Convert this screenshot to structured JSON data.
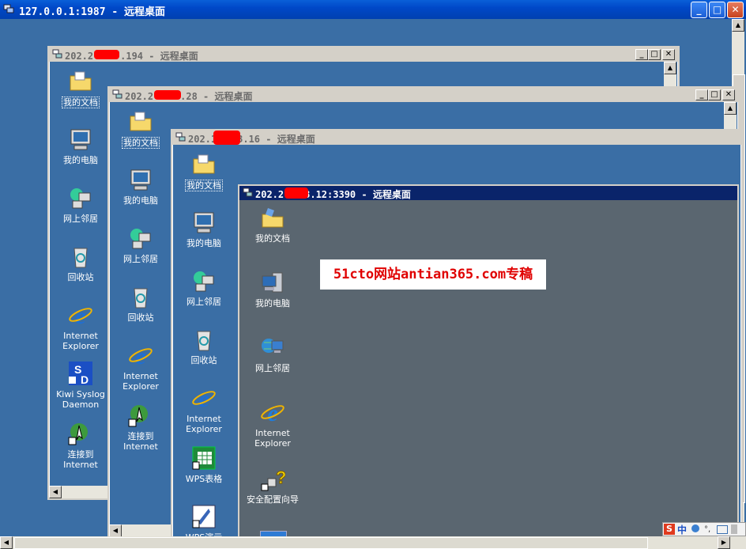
{
  "outer": {
    "title": "127.0.0.1:1987 - 远程桌面",
    "minimize": "_",
    "maximize": "□",
    "close": "✕"
  },
  "windows": [
    {
      "title_prefix": "202.2",
      "title_suffix": ".194 - 远程桌面",
      "icons": [
        {
          "label": "我的文档",
          "icon": "folder-icon"
        },
        {
          "label": "我的电脑",
          "icon": "computer-icon"
        },
        {
          "label": "网上邻居",
          "icon": "network-icon"
        },
        {
          "label": "回收站",
          "icon": "recycle-bin-icon"
        },
        {
          "label": "Internet Explorer",
          "icon": "ie-icon"
        },
        {
          "label": "Kiwi Syslog Daemon",
          "icon": "kiwi-icon"
        },
        {
          "label": "连接到 Internet",
          "icon": "connect-icon"
        }
      ]
    },
    {
      "title_prefix": "202.2",
      "title_suffix": ".28 - 远程桌面",
      "icons": [
        {
          "label": "我的文档",
          "icon": "folder-icon"
        },
        {
          "label": "我的电脑",
          "icon": "computer-icon"
        },
        {
          "label": "网上邻居",
          "icon": "network-icon"
        },
        {
          "label": "回收站",
          "icon": "recycle-bin-icon"
        },
        {
          "label": "Internet Explorer",
          "icon": "ie-icon"
        },
        {
          "label": "连接到 Internet",
          "icon": "connect-icon"
        }
      ]
    },
    {
      "title_prefix": "202.1",
      "title_suffix": "3.16 - 远程桌面",
      "icons": [
        {
          "label": "我的文档",
          "icon": "folder-icon"
        },
        {
          "label": "我的电脑",
          "icon": "computer-icon"
        },
        {
          "label": "网上邻居",
          "icon": "network-icon"
        },
        {
          "label": "回收站",
          "icon": "recycle-bin-icon"
        },
        {
          "label": "Internet Explorer",
          "icon": "ie-icon"
        },
        {
          "label": "WPS表格",
          "icon": "wps-table-icon"
        },
        {
          "label": "WPS演示",
          "icon": "wps-icon"
        }
      ]
    },
    {
      "title_prefix": "202.2",
      "title_suffix": "3.12:3390 - 远程桌面",
      "icons": [
        {
          "label": "我的文档",
          "icon": "folder-icon"
        },
        {
          "label": "我的电脑",
          "icon": "computer-icon"
        },
        {
          "label": "网上邻居",
          "icon": "network-icon"
        },
        {
          "label": "Internet Explorer",
          "icon": "ie-icon"
        },
        {
          "label": "安全配置向导",
          "icon": "security-wizard-icon"
        }
      ]
    }
  ],
  "watermark": "51cto网站antian365.com专稿",
  "ime_bar": {
    "s": "S",
    "lang": "中"
  },
  "colors": {
    "desktop": "#3a6ea5",
    "server_desktop": "#5a6670",
    "active_title": "#0a246a",
    "redaction": "#ff0000"
  }
}
